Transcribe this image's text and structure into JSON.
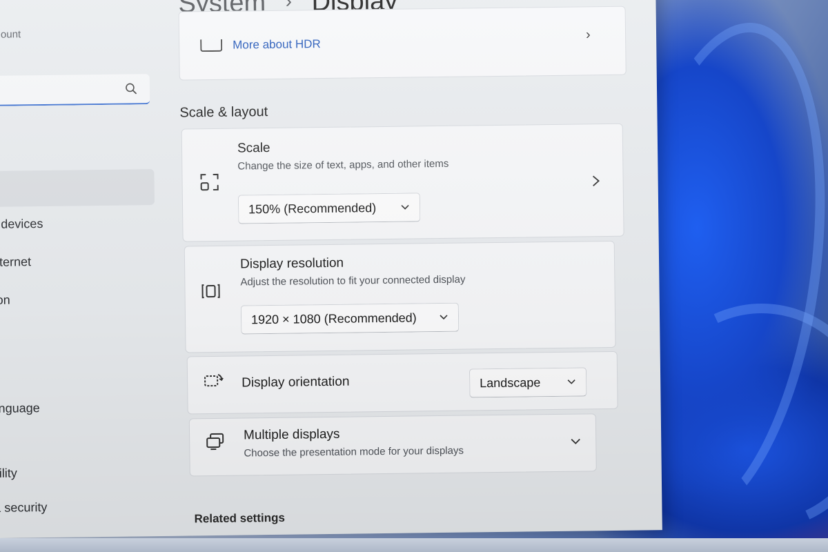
{
  "window": {
    "breadcrumb_parent": "System",
    "breadcrumb_separator": "›",
    "breadcrumb_current": "Display"
  },
  "sidebar": {
    "account_label": "ount",
    "search": {
      "value": "",
      "placeholder": "",
      "icon": "search-icon"
    },
    "items": [
      {
        "label": "& devices"
      },
      {
        "label": "internet"
      },
      {
        "label": "tion"
      },
      {
        "label": "anguage"
      },
      {
        "label": "bility"
      },
      {
        "label": "& security"
      }
    ]
  },
  "hdr": {
    "link_label": "More about HDR",
    "icon": "hdr-icon",
    "chevron": "›"
  },
  "section": {
    "title": "Scale & layout"
  },
  "scale": {
    "title": "Scale",
    "subtitle": "Change the size of text, apps, and other items",
    "value": "150% (Recommended)",
    "icon": "scale-icon"
  },
  "resolution": {
    "title": "Display resolution",
    "subtitle": "Adjust the resolution to fit your connected display",
    "value": "1920 × 1080 (Recommended)",
    "icon": "resolution-icon"
  },
  "orientation": {
    "title": "Display orientation",
    "value": "Landscape",
    "icon": "orientation-icon"
  },
  "multiple": {
    "title": "Multiple displays",
    "subtitle": "Choose the presentation mode for your displays",
    "icon": "multiple-displays-icon"
  },
  "related": {
    "title": "Related settings"
  },
  "colors": {
    "accent": "#1f55b8",
    "window_bg": "#e9ecef",
    "card_bg": "#f7f8fa",
    "wallpaper_blue": "#1646c9"
  }
}
